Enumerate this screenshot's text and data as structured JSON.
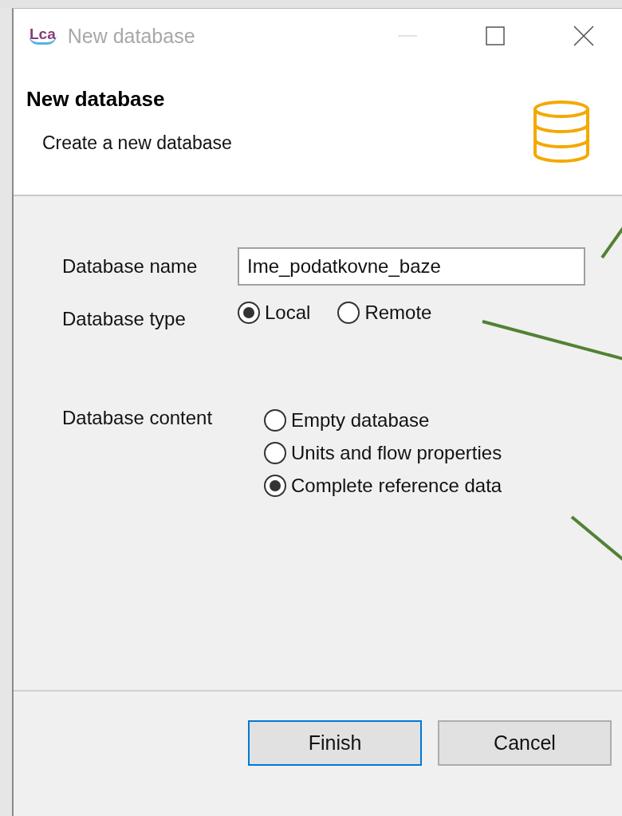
{
  "window": {
    "logo": "Lca",
    "title": "New database"
  },
  "header": {
    "title": "New database",
    "description": "Create a new database"
  },
  "name_field": {
    "label": "Database name",
    "value": "Ime_podatkovne_baze"
  },
  "type_group": {
    "label": "Database type",
    "options": [
      {
        "label": "Local",
        "selected": true
      },
      {
        "label": "Remote",
        "selected": false
      }
    ]
  },
  "content_group": {
    "label": "Database content",
    "options": [
      {
        "label": "Empty database",
        "selected": false
      },
      {
        "label": "Units and flow properties",
        "selected": false
      },
      {
        "label": "Complete reference data",
        "selected": true
      }
    ]
  },
  "buttons": [
    {
      "label": "Finish",
      "default": true
    },
    {
      "label": "Cancel",
      "default": false
    }
  ]
}
